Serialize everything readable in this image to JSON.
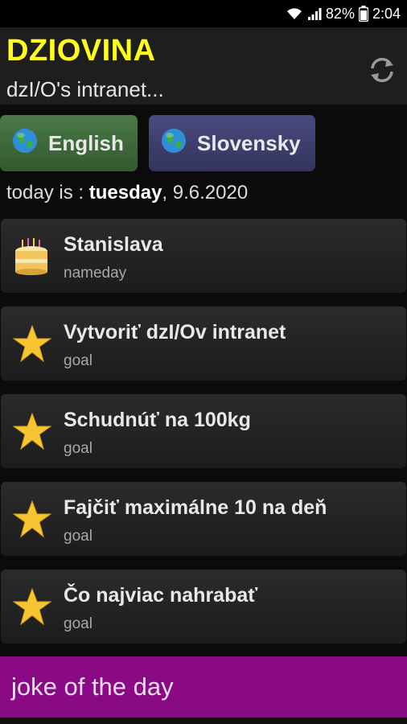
{
  "status_bar": {
    "battery": "82%",
    "time": "2:04",
    "icons": [
      "wifi-icon",
      "signal-icon",
      "battery-icon"
    ]
  },
  "header": {
    "title": "DZIOVINA",
    "subtitle": "dzI/O's intranet...",
    "title_color": "#ffff19",
    "refresh_icon": "refresh-icon"
  },
  "languages": {
    "english": "English",
    "slovensky": "Slovensky",
    "english_color": "#3f6b3c",
    "slovensky_color": "#3d3d6e"
  },
  "today": {
    "prefix": "today is : ",
    "day": "tuesday",
    "date": ", 9.6.2020"
  },
  "items": [
    {
      "title": "Stanislava",
      "subtitle": "nameday",
      "icon": "cake-icon"
    },
    {
      "title": "Vytvoriť dzI/Ov intranet",
      "subtitle": "goal",
      "icon": "star-icon"
    },
    {
      "title": "Schudnúť na 100kg",
      "subtitle": "goal",
      "icon": "star-icon"
    },
    {
      "title": "Fajčiť maximálne 10 na deň",
      "subtitle": "goal",
      "icon": "star-icon"
    },
    {
      "title": "Čo najviac nahrabať",
      "subtitle": "goal",
      "icon": "star-icon"
    }
  ],
  "joke": {
    "label": "joke of the day",
    "color": "#8a0a86"
  }
}
